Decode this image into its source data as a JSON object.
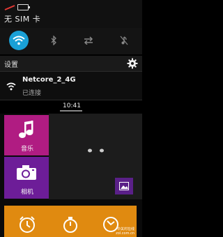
{
  "status_bar": {
    "carrier": "无 SIM 卡",
    "icons": [
      "no-sim-icon",
      "battery-icon"
    ]
  },
  "quick_toggles": [
    {
      "name": "wifi",
      "icon": "wifi-icon",
      "active": true
    },
    {
      "name": "bluetooth",
      "icon": "bluetooth-icon",
      "active": false
    },
    {
      "name": "data",
      "icon": "data-transfer-icon",
      "active": false
    },
    {
      "name": "sound",
      "icon": "sound-off-icon",
      "active": false
    }
  ],
  "settings": {
    "label": "设置",
    "icon": "gear-icon"
  },
  "notification": {
    "network_name": "Netcore_2_4G",
    "status": "已连接",
    "icon": "wifi-icon"
  },
  "clock": "10:41",
  "home": {
    "apps": [
      {
        "label": "音乐",
        "icon": "music-note-icon",
        "color": "#b01c82"
      },
      {
        "label": "相机",
        "icon": "camera-icon",
        "color": "#6d1d98"
      }
    ],
    "bottom_icons": [
      "alarm-clock-icon",
      "timer-icon",
      "clock-icon"
    ],
    "watermark_text": "中关村在线",
    "watermark_url": "zol.com.cn"
  },
  "colors": {
    "accent": "#1aa0d6",
    "music_tile": "#b01c82",
    "camera_tile": "#6d1d98",
    "bottom_strip": "#e08a10"
  }
}
